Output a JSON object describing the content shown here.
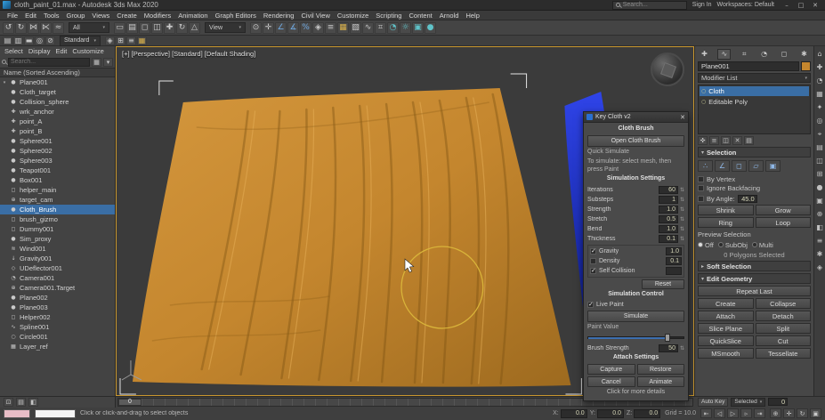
{
  "colors": {
    "cloth": "#c4862e",
    "selection": "#3a6ea5",
    "accent_blue": "#2a6fd0",
    "brush": "#d9b43a",
    "blue_object": "#2233cc",
    "viewport_border": "#c9972f"
  },
  "icons": {
    "dropdown_arrow": "▾",
    "spinner": "⇅",
    "bulb": "○"
  },
  "titlebar": {
    "title": "cloth_paint_01.max - Autodesk 3ds Max 2020",
    "search_hint": "Search...",
    "sign_in": "Sign In",
    "workspaces": "Workspaces: Default",
    "window_buttons": [
      {
        "name": "minimize-button",
        "glyph": "–"
      },
      {
        "name": "maximize-button",
        "glyph": "□"
      },
      {
        "name": "close-button",
        "glyph": "✕"
      }
    ]
  },
  "menubar": {
    "items": [
      "File",
      "Edit",
      "Tools",
      "Group",
      "Views",
      "Create",
      "Modifiers",
      "Animation",
      "Graph Editors",
      "Rendering",
      "Civil View",
      "Customize",
      "Scripting",
      "Content",
      "Arnold",
      "Help"
    ]
  },
  "toolbar_main": {
    "filter_value": "All",
    "coord_value": "View",
    "icons_a": [
      {
        "name": "undo-icon",
        "glyph": "↺"
      },
      {
        "name": "redo-icon",
        "glyph": "↻"
      },
      {
        "name": "select-and-link-icon",
        "glyph": "⋈"
      },
      {
        "name": "unlink-selection-icon",
        "glyph": "⋉"
      },
      {
        "name": "bind-to-space-warp-icon",
        "glyph": "≈"
      }
    ],
    "icons_b": [
      {
        "name": "select-object-icon",
        "glyph": "▭"
      },
      {
        "name": "select-by-name-icon",
        "glyph": "▤"
      },
      {
        "name": "rectangular-selection-region-icon",
        "glyph": "◻"
      },
      {
        "name": "window-crossing-toggle-icon",
        "glyph": "◫"
      },
      {
        "name": "select-and-move-icon",
        "glyph": "✚"
      },
      {
        "name": "select-and-rotate-icon",
        "glyph": "↻"
      },
      {
        "name": "select-and-scale-icon",
        "glyph": "△"
      }
    ],
    "icons_c": [
      {
        "name": "use-pivot-center-icon",
        "glyph": "⊙"
      },
      {
        "name": "select-and-manipulate-icon",
        "glyph": "✛"
      },
      {
        "name": "snap-toggle-icon",
        "glyph": "∠",
        "cls": "tone-blue"
      },
      {
        "name": "angle-snap-icon",
        "glyph": "∡",
        "cls": "tone-blue"
      },
      {
        "name": "percent-snap-icon",
        "glyph": "%",
        "cls": "tone-blue"
      },
      {
        "name": "mirror-icon",
        "glyph": "◈"
      },
      {
        "name": "align-icon",
        "glyph": "≡"
      },
      {
        "name": "layer-manager-icon",
        "glyph": "▦",
        "cls": "tone-gold"
      },
      {
        "name": "graphite-ribbon-icon",
        "glyph": "▧"
      },
      {
        "name": "curve-editor-icon",
        "glyph": "∿"
      },
      {
        "name": "schematic-view-icon",
        "glyph": "⌗"
      },
      {
        "name": "material-editor-icon",
        "glyph": "◔",
        "cls": "tone-teal"
      },
      {
        "name": "render-setup-icon",
        "glyph": "☼",
        "cls": "tone-teal"
      },
      {
        "name": "rendered-frame-window-icon",
        "glyph": "▣",
        "cls": "tone-teal"
      },
      {
        "name": "render-production-icon",
        "glyph": "●",
        "cls": "tone-teal"
      }
    ]
  },
  "toolbar_secondary": {
    "dropdown_value": "Standard",
    "icons_a": [
      {
        "name": "scene-explorer-toggle-icon",
        "glyph": "▤"
      },
      {
        "name": "layer-explorer-icon",
        "glyph": "▥"
      },
      {
        "name": "ribbon-toggle-icon",
        "glyph": "▬"
      },
      {
        "name": "isolate-selection-icon",
        "glyph": "◎"
      },
      {
        "name": "selection-lock-icon",
        "glyph": "⊘"
      }
    ],
    "icons_b": [
      {
        "name": "mirror-tool-icon",
        "glyph": "◈"
      },
      {
        "name": "array-tool-icon",
        "glyph": "⊞"
      },
      {
        "name": "align-tool-icon",
        "glyph": "≡"
      },
      {
        "name": "color-clipboard-icon",
        "glyph": "▦",
        "cls": "tone-gold"
      }
    ]
  },
  "explorer": {
    "menus": [
      "Select",
      "Display",
      "Edit",
      "Customize"
    ],
    "search_placeholder": "Search...",
    "btn1_glyph": "▦",
    "btn2_glyph": "▾",
    "header": "Name (Sorted Ascending)",
    "footer_icons": [
      {
        "name": "lock-ui-layout-icon",
        "glyph": "⊡",
        "cls": "tone-blue"
      },
      {
        "name": "new-scene-explorer-icon",
        "glyph": "▤",
        "cls": "tone-green"
      },
      {
        "name": "toggle-layer-explorer-icon",
        "glyph": "◧"
      }
    ],
    "items": [
      {
        "name": "Plane001",
        "glyph": "●",
        "twist": "▾"
      },
      {
        "name": "Cloth_target",
        "glyph": "●"
      },
      {
        "name": "Collision_sphere",
        "glyph": "●"
      },
      {
        "name": "wrk_anchor",
        "glyph": "✚"
      },
      {
        "name": "point_A",
        "glyph": "✚"
      },
      {
        "name": "point_B",
        "glyph": "✚"
      },
      {
        "name": "Sphere001",
        "glyph": "●"
      },
      {
        "name": "Sphere002",
        "glyph": "●"
      },
      {
        "name": "Sphere003",
        "glyph": "●"
      },
      {
        "name": "Teapot001",
        "glyph": "●"
      },
      {
        "name": "Box001",
        "glyph": "●"
      },
      {
        "name": "helper_main",
        "glyph": "◻"
      },
      {
        "name": "target_cam",
        "glyph": "⊕"
      },
      {
        "name": "Cloth_Brush",
        "glyph": "●",
        "cls": "selected"
      },
      {
        "name": "brush_gizmo",
        "glyph": "◻"
      },
      {
        "name": "Dummy001",
        "glyph": "◻"
      },
      {
        "name": "Sim_proxy",
        "glyph": "●"
      },
      {
        "name": "Wind001",
        "glyph": "≋"
      },
      {
        "name": "Gravity001",
        "glyph": "↓"
      },
      {
        "name": "UDeflector001",
        "glyph": "◇"
      },
      {
        "name": "Camera001",
        "glyph": "◔"
      },
      {
        "name": "Camera001.Target",
        "glyph": "⊕"
      },
      {
        "name": "Plane002",
        "glyph": "●"
      },
      {
        "name": "Plane003",
        "glyph": "●"
      },
      {
        "name": "Helper002",
        "glyph": "◻"
      },
      {
        "name": "Spline001",
        "glyph": "∿"
      },
      {
        "name": "Circle001",
        "glyph": "○"
      },
      {
        "name": "Layer_ref",
        "glyph": "▦"
      }
    ]
  },
  "viewport": {
    "label": "[+] [Perspective] [Standard] [Default Shading]"
  },
  "dialog": {
    "title": "Key Cloth v2",
    "close": "✕",
    "section_brush": "Cloth Brush",
    "open_brush": "Open Cloth Brush",
    "desc1": "Quick Simulate",
    "desc2": "To simulate: select mesh, then press Paint",
    "section_settings": "Simulation Settings",
    "params": [
      {
        "label": "Iterations",
        "value": "60"
      },
      {
        "label": "Substeps",
        "value": "1"
      },
      {
        "label": "Strength",
        "value": "1.0"
      },
      {
        "label": "Stretch",
        "value": "0.5"
      },
      {
        "label": "Bend",
        "value": "1.0"
      },
      {
        "label": "Thickness",
        "value": "0.1"
      }
    ],
    "checks": [
      {
        "label": "Gravity",
        "value": "1.0",
        "cls": "checked"
      },
      {
        "label": "Density",
        "value": "0.1"
      },
      {
        "label": "Self Collision",
        "value": "",
        "cls": "checked"
      }
    ],
    "reset": "Reset",
    "section_control": "Simulation Control",
    "live_paint": "Live Paint",
    "simulate": "Simulate",
    "paint_value_label": "Paint Value",
    "brush_strength_label": "Brush Strength",
    "brush_strength_value": "50",
    "section_attach": "Attach Settings",
    "buttons": [
      "Capture",
      "Restore",
      "Cancel",
      "Animate"
    ],
    "footer": "Click for more details"
  },
  "command_panel": {
    "tabs": [
      {
        "name": "create-tab",
        "glyph": "✚"
      },
      {
        "name": "modify-tab",
        "glyph": "∿",
        "cls": "active"
      },
      {
        "name": "hierarchy-tab",
        "glyph": "⌗"
      },
      {
        "name": "motion-tab",
        "glyph": "◔"
      },
      {
        "name": "display-tab",
        "glyph": "◻"
      },
      {
        "name": "utilities-tab",
        "glyph": "✱"
      }
    ],
    "name_value": "Plane001",
    "modifier_list_label": "Modifier List",
    "stack": [
      {
        "label": "Cloth",
        "cls": "selected"
      },
      {
        "label": "Editable Poly"
      }
    ],
    "stack_tools": [
      {
        "name": "pin-stack-icon",
        "glyph": "✜"
      },
      {
        "name": "show-end-result-icon",
        "glyph": "≡"
      },
      {
        "name": "make-unique-icon",
        "glyph": "◫"
      },
      {
        "name": "remove-modifier-icon",
        "glyph": "✕"
      },
      {
        "name": "configure-modifier-sets-icon",
        "glyph": "▤"
      }
    ],
    "selection": {
      "title": "Selection",
      "arrow": "▾",
      "icons": [
        {
          "name": "vertex-subobject-icon",
          "glyph": "∴"
        },
        {
          "name": "edge-subobject-icon",
          "glyph": "∠"
        },
        {
          "name": "border-subobject-icon",
          "glyph": "◻"
        },
        {
          "name": "polygon-subobject-icon",
          "glyph": "▱"
        },
        {
          "name": "element-subobject-icon",
          "glyph": "▣"
        }
      ],
      "checks": [
        "By Vertex",
        "Ignore Backfacing"
      ],
      "angle_label": "By Angle:",
      "angle_value": "45.0",
      "buttons": [
        "Shrink",
        "Grow",
        "Ring",
        "Loop"
      ],
      "preview_label": "Preview Selection",
      "preview_options": [
        {
          "label": "Off",
          "cls": "on"
        },
        {
          "label": "SubObj"
        },
        {
          "label": "Multi"
        }
      ],
      "status": "0 Polygons Selected"
    },
    "soft_selection": {
      "title": "Soft Selection",
      "arrow": "▸"
    },
    "edit_geometry": {
      "title": "Edit Geometry",
      "arrow": "▾",
      "repeat_last": "Repeat Last",
      "buttons": [
        "Create",
        "Collapse",
        "Attach",
        "Detach",
        "Slice Plane",
        "Split",
        "QuickSlice",
        "Cut",
        "MSmooth",
        "Tessellate"
      ]
    }
  },
  "rightstrip": {
    "icons": [
      {
        "name": "home-grid-icon",
        "glyph": "⌂",
        "cls": "tone-gold"
      },
      {
        "name": "create-shortcut-icon",
        "glyph": "✚"
      },
      {
        "name": "material-shortcut-icon",
        "glyph": "◔",
        "cls": "tone-teal"
      },
      {
        "name": "layers-shortcut-icon",
        "glyph": "▦",
        "cls": "tone-gold"
      },
      {
        "name": "light-shortcut-icon",
        "glyph": "✦",
        "cls": "tone-gold"
      },
      {
        "name": "camera-shortcut-icon",
        "glyph": "◎"
      },
      {
        "name": "target-shortcut-icon",
        "glyph": "⌖",
        "cls": "tone-red"
      },
      {
        "name": "grid-shortcut-icon",
        "glyph": "▤"
      },
      {
        "name": "mirror-shortcut-icon",
        "glyph": "◫"
      },
      {
        "name": "array-shortcut-icon",
        "glyph": "⊞"
      },
      {
        "name": "sphere-shortcut-icon",
        "glyph": "●",
        "cls": "tone-teal"
      },
      {
        "name": "box-shortcut-icon",
        "glyph": "▣",
        "cls": "tone-gold"
      },
      {
        "name": "snap-shortcut-icon",
        "glyph": "⊕",
        "cls": "tone-blue"
      },
      {
        "name": "shade-shortcut-icon",
        "glyph": "◧"
      },
      {
        "name": "align-shortcut-icon",
        "glyph": "≡"
      },
      {
        "name": "star-shortcut-icon",
        "glyph": "✱",
        "cls": "tone-gold"
      },
      {
        "name": "diamond-shortcut-icon",
        "glyph": "◈",
        "cls": "tone-teal"
      }
    ]
  },
  "trackbar": {
    "handle": "0"
  },
  "statusbar": {
    "status_line": "Click or click-and-drag to select objects",
    "auto_key": "Auto Key",
    "selected_label": "Selected",
    "frame": "0",
    "coords": [
      {
        "label": "X:",
        "value": "0.0"
      },
      {
        "label": "Y:",
        "value": "0.0"
      },
      {
        "label": "Z:",
        "value": "0.0"
      }
    ],
    "grid": "Grid = 10.0",
    "playback": [
      {
        "name": "go-to-start-icon",
        "glyph": "⇤"
      },
      {
        "name": "previous-frame-icon",
        "glyph": "◁"
      },
      {
        "name": "play-icon",
        "glyph": "▷"
      },
      {
        "name": "next-frame-icon",
        "glyph": "▹"
      },
      {
        "name": "go-to-end-icon",
        "glyph": "⇥"
      }
    ],
    "nav_icons": [
      {
        "name": "zoom-icon",
        "glyph": "⊕"
      },
      {
        "name": "pan-icon",
        "glyph": "✛"
      },
      {
        "name": "orbit-icon",
        "glyph": "↻"
      },
      {
        "name": "maximize-viewport-icon",
        "glyph": "▣"
      }
    ]
  }
}
